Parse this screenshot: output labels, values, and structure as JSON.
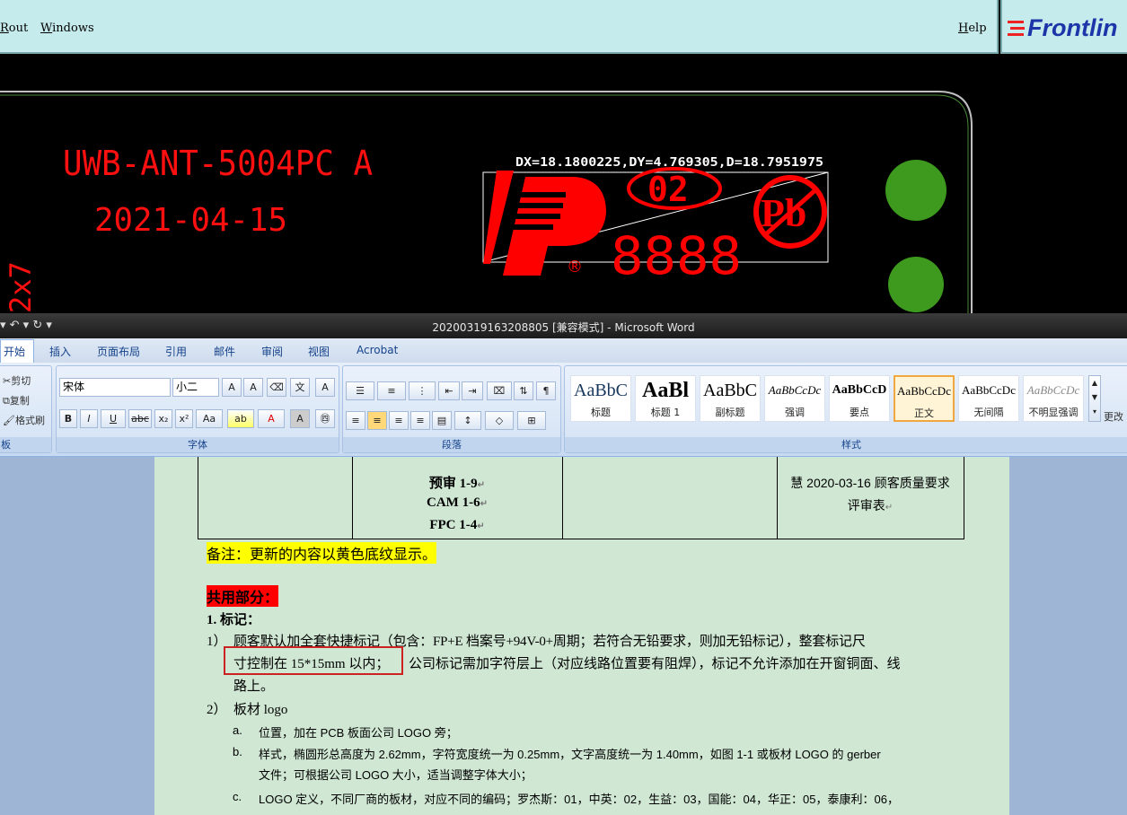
{
  "cam": {
    "menu": [
      "Rout",
      "Windows"
    ],
    "help": "Help",
    "logo": "Frontlin",
    "board_text": "UWB-ANT-5004PC A",
    "date_text": "2021-04-15",
    "side_text": "2x7",
    "measure": "DX=18.1800225,DY=4.769305,D=18.7951975",
    "logo_code": "02",
    "date_code": "8888",
    "pb_mark": "Pb",
    "reg_mark": "®",
    "colors": {
      "silk": "#ff0000",
      "pad": "#3d9a1e",
      "outline": "#bfbfbf"
    }
  },
  "word": {
    "title": "20200319163208805 [兼容模式] - Microsoft Word",
    "qat_glyphs": "▾ ↶ ▾ ↻ ▾",
    "tabs": [
      "开始",
      "插入",
      "页面布局",
      "引用",
      "邮件",
      "审阅",
      "视图",
      "Acrobat"
    ],
    "clipboard": {
      "cut": "剪切",
      "copy": "复制",
      "painter": "格式刷",
      "label": "板"
    },
    "font": {
      "name": "宋体",
      "size": "小二",
      "label": "字体"
    },
    "paragraph": {
      "label": "段落"
    },
    "styles": {
      "label": "样式",
      "items": [
        {
          "preview": "AaBbC",
          "name": "标题"
        },
        {
          "preview": "AaBl",
          "name": "标题 1"
        },
        {
          "preview": "AaBbC",
          "name": "副标题"
        },
        {
          "preview": "AaBbCcDc",
          "name": "强调"
        },
        {
          "preview": "AaBbCcD",
          "name": "要点"
        },
        {
          "preview": "AaBbCcDc",
          "name": "正文"
        },
        {
          "preview": "AaBbCcDc",
          "name": "无间隔"
        },
        {
          "preview": "AaBbCcDc",
          "name": "不明显强调"
        }
      ],
      "change": "更改"
    }
  },
  "doc": {
    "table": {
      "col2": [
        "预审 1-9",
        "CAM 1-6",
        "FPC 1-4"
      ],
      "col4": [
        "慧 2020-03-16 顾客质量要求",
        "评审表"
      ]
    },
    "note": "备注：更新的内容以黄色底纹显示。",
    "section": "共用部分：",
    "heading": "1.    标记：",
    "item1_num": "1）",
    "item1_line1": "顾客默认加全套快捷标记（包含：FP+E 档案号+94V-0+周期；若符合无铅要求，则加无铅标记），整套标记尺",
    "item1_boxed": "寸控制在 15*15mm 以内；",
    "item1_rest": "公司标记需加字符层上（对应线路位置要有阻焊），标记不允许添加在开窗铜面、线",
    "item1_line3": "路上。",
    "item2_num": "2）",
    "item2": "板材 logo",
    "a_mark": "a.",
    "a_text": "位置，加在 PCB 板面公司 LOGO 旁；",
    "b_mark": "b.",
    "b_line1": "样式，椭圆形总高度为 2.62mm，字符宽度统一为 0.25mm，文字高度统一为 1.40mm，如图 1-1 或板材 LOGO 的 gerber",
    "b_line2": "文件；可根据公司 LOGO 大小，适当调整字体大小；",
    "c_mark": "c.",
    "c_line1": "LOGO 定义，不同厂商的板材，对应不同的编码；罗杰斯：01，中英：02，生益：03，国能：04，华正：05，泰康利：06，"
  }
}
